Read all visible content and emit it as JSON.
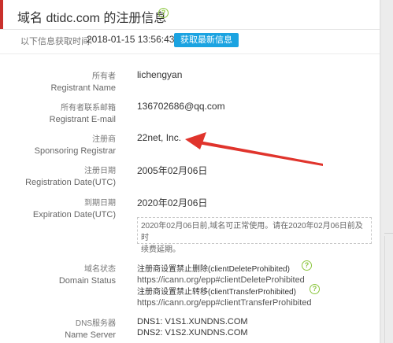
{
  "header": {
    "title_prefix": "域名",
    "domain": "dtidc.com",
    "title_suffix": "的注册信息"
  },
  "fetch": {
    "label": "以下信息获取时间:",
    "time": "2018-01-15 13:56:43",
    "refresh_label": "获取最新信息"
  },
  "fields": {
    "registrant": {
      "cn": "所有者",
      "en": "Registrant Name",
      "value": "lichengyan"
    },
    "email": {
      "cn": "所有者联系邮箱",
      "en": "Registrant E-mail",
      "value": "136702686@qq.com"
    },
    "registrar": {
      "cn": "注册商",
      "en": "Sponsoring Registrar",
      "value": "22net, Inc."
    },
    "reg_date": {
      "cn": "注册日期",
      "en": "Registration Date(UTC)",
      "value": "2005年02月06日"
    },
    "exp_date": {
      "cn": "到期日期",
      "en": "Expiration Date(UTC)",
      "value": "2020年02月06日"
    }
  },
  "notice": {
    "line1": "2020年02月06日前,域名可正常使用。请在2020年02月06日前及时",
    "line2": "续费延期。"
  },
  "status": {
    "cn": "域名状态",
    "en": "Domain Status",
    "items": [
      {
        "label": "注册商设置禁止删除(clientDeleteProhibited)",
        "url": "https://icann.org/epp#clientDeleteProhibited"
      },
      {
        "label": "注册商设置禁止转移(clientTransferProhibited)",
        "url": "https://icann.org/epp#clientTransferProhibited"
      }
    ]
  },
  "dns": {
    "cn": "DNS服务器",
    "en": "Name Server",
    "servers": [
      "DNS1: V1S1.XUNDNS.COM",
      "DNS2: V1S2.XUNDNS.COM"
    ]
  },
  "help_glyph": "?",
  "colors": {
    "accent": "#c9302c",
    "button": "#1ba3e1",
    "help": "#8cc63f",
    "arrow": "#e0342c"
  }
}
